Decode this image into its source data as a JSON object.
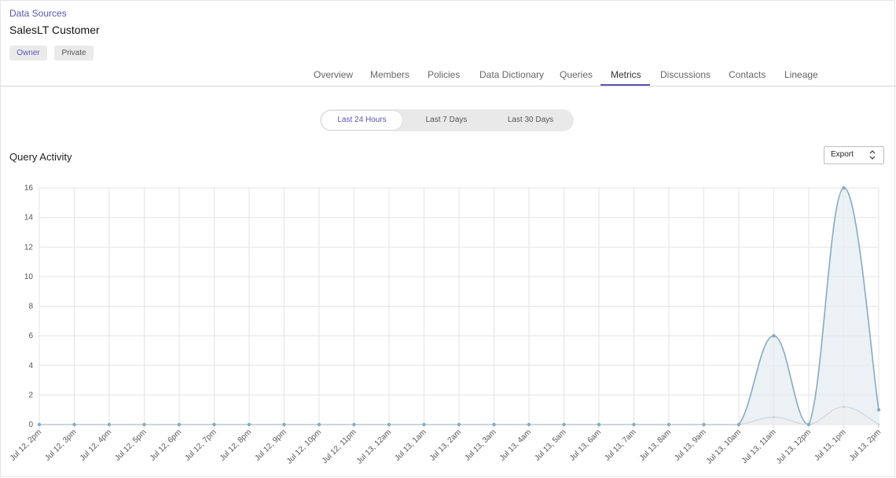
{
  "header": {
    "breadcrumb": "Data Sources",
    "title": "SalesLT Customer",
    "badges": [
      "Owner",
      "Private"
    ]
  },
  "tabs": [
    {
      "label": "Overview"
    },
    {
      "label": "Members"
    },
    {
      "label": "Policies"
    },
    {
      "label": "Data Dictionary"
    },
    {
      "label": "Queries"
    },
    {
      "label": "Metrics"
    },
    {
      "label": "Discussions"
    },
    {
      "label": "Contacts"
    },
    {
      "label": "Lineage"
    }
  ],
  "active_tab": "Metrics",
  "time_range": {
    "options": [
      "Last 24 Hours",
      "Last 7 Days",
      "Last 30 Days"
    ],
    "selected": "Last 24 Hours"
  },
  "section": {
    "title": "Query Activity",
    "export_label": "Export"
  },
  "colors": {
    "accent": "#5b54b3",
    "series_primary": "#86aac3",
    "series_secondary": "#cfd6d8",
    "area_fill": "#e4ecf0",
    "grid": "#e3e3e3"
  },
  "chart_data": {
    "type": "line",
    "title": "Query Activity",
    "xlabel": "",
    "ylabel": "",
    "ylim": [
      0,
      16
    ],
    "y_ticks": [
      0,
      2,
      4,
      6,
      8,
      10,
      12,
      14,
      16
    ],
    "grid": true,
    "legend": "none",
    "categories": [
      "Jul 12, 2pm",
      "Jul 12, 3pm",
      "Jul 12, 4pm",
      "Jul 12, 5pm",
      "Jul 12, 6pm",
      "Jul 12, 7pm",
      "Jul 12, 8pm",
      "Jul 12, 9pm",
      "Jul 12, 10pm",
      "Jul 12, 11pm",
      "Jul 13, 12am",
      "Jul 13, 1am",
      "Jul 13, 2am",
      "Jul 13, 3am",
      "Jul 13, 4am",
      "Jul 13, 5am",
      "Jul 13, 6am",
      "Jul 13, 7am",
      "Jul 13, 8am",
      "Jul 13, 9am",
      "Jul 13, 10am",
      "Jul 13, 11am",
      "Jul 13, 12pm",
      "Jul 13, 1pm",
      "Jul 13, 2pm"
    ],
    "series": [
      {
        "values": [
          0,
          0,
          0,
          0,
          0,
          0,
          0,
          0,
          0,
          0,
          0,
          0,
          0,
          0,
          0,
          0,
          0,
          0,
          0,
          0,
          0,
          6,
          0,
          16,
          1
        ]
      },
      {
        "values": [
          0,
          0,
          0,
          0,
          0,
          0,
          0,
          0,
          0,
          0,
          0,
          0,
          0,
          0,
          0,
          0,
          0,
          0,
          0,
          0,
          0,
          0.5,
          0,
          1.2,
          0
        ]
      }
    ]
  }
}
